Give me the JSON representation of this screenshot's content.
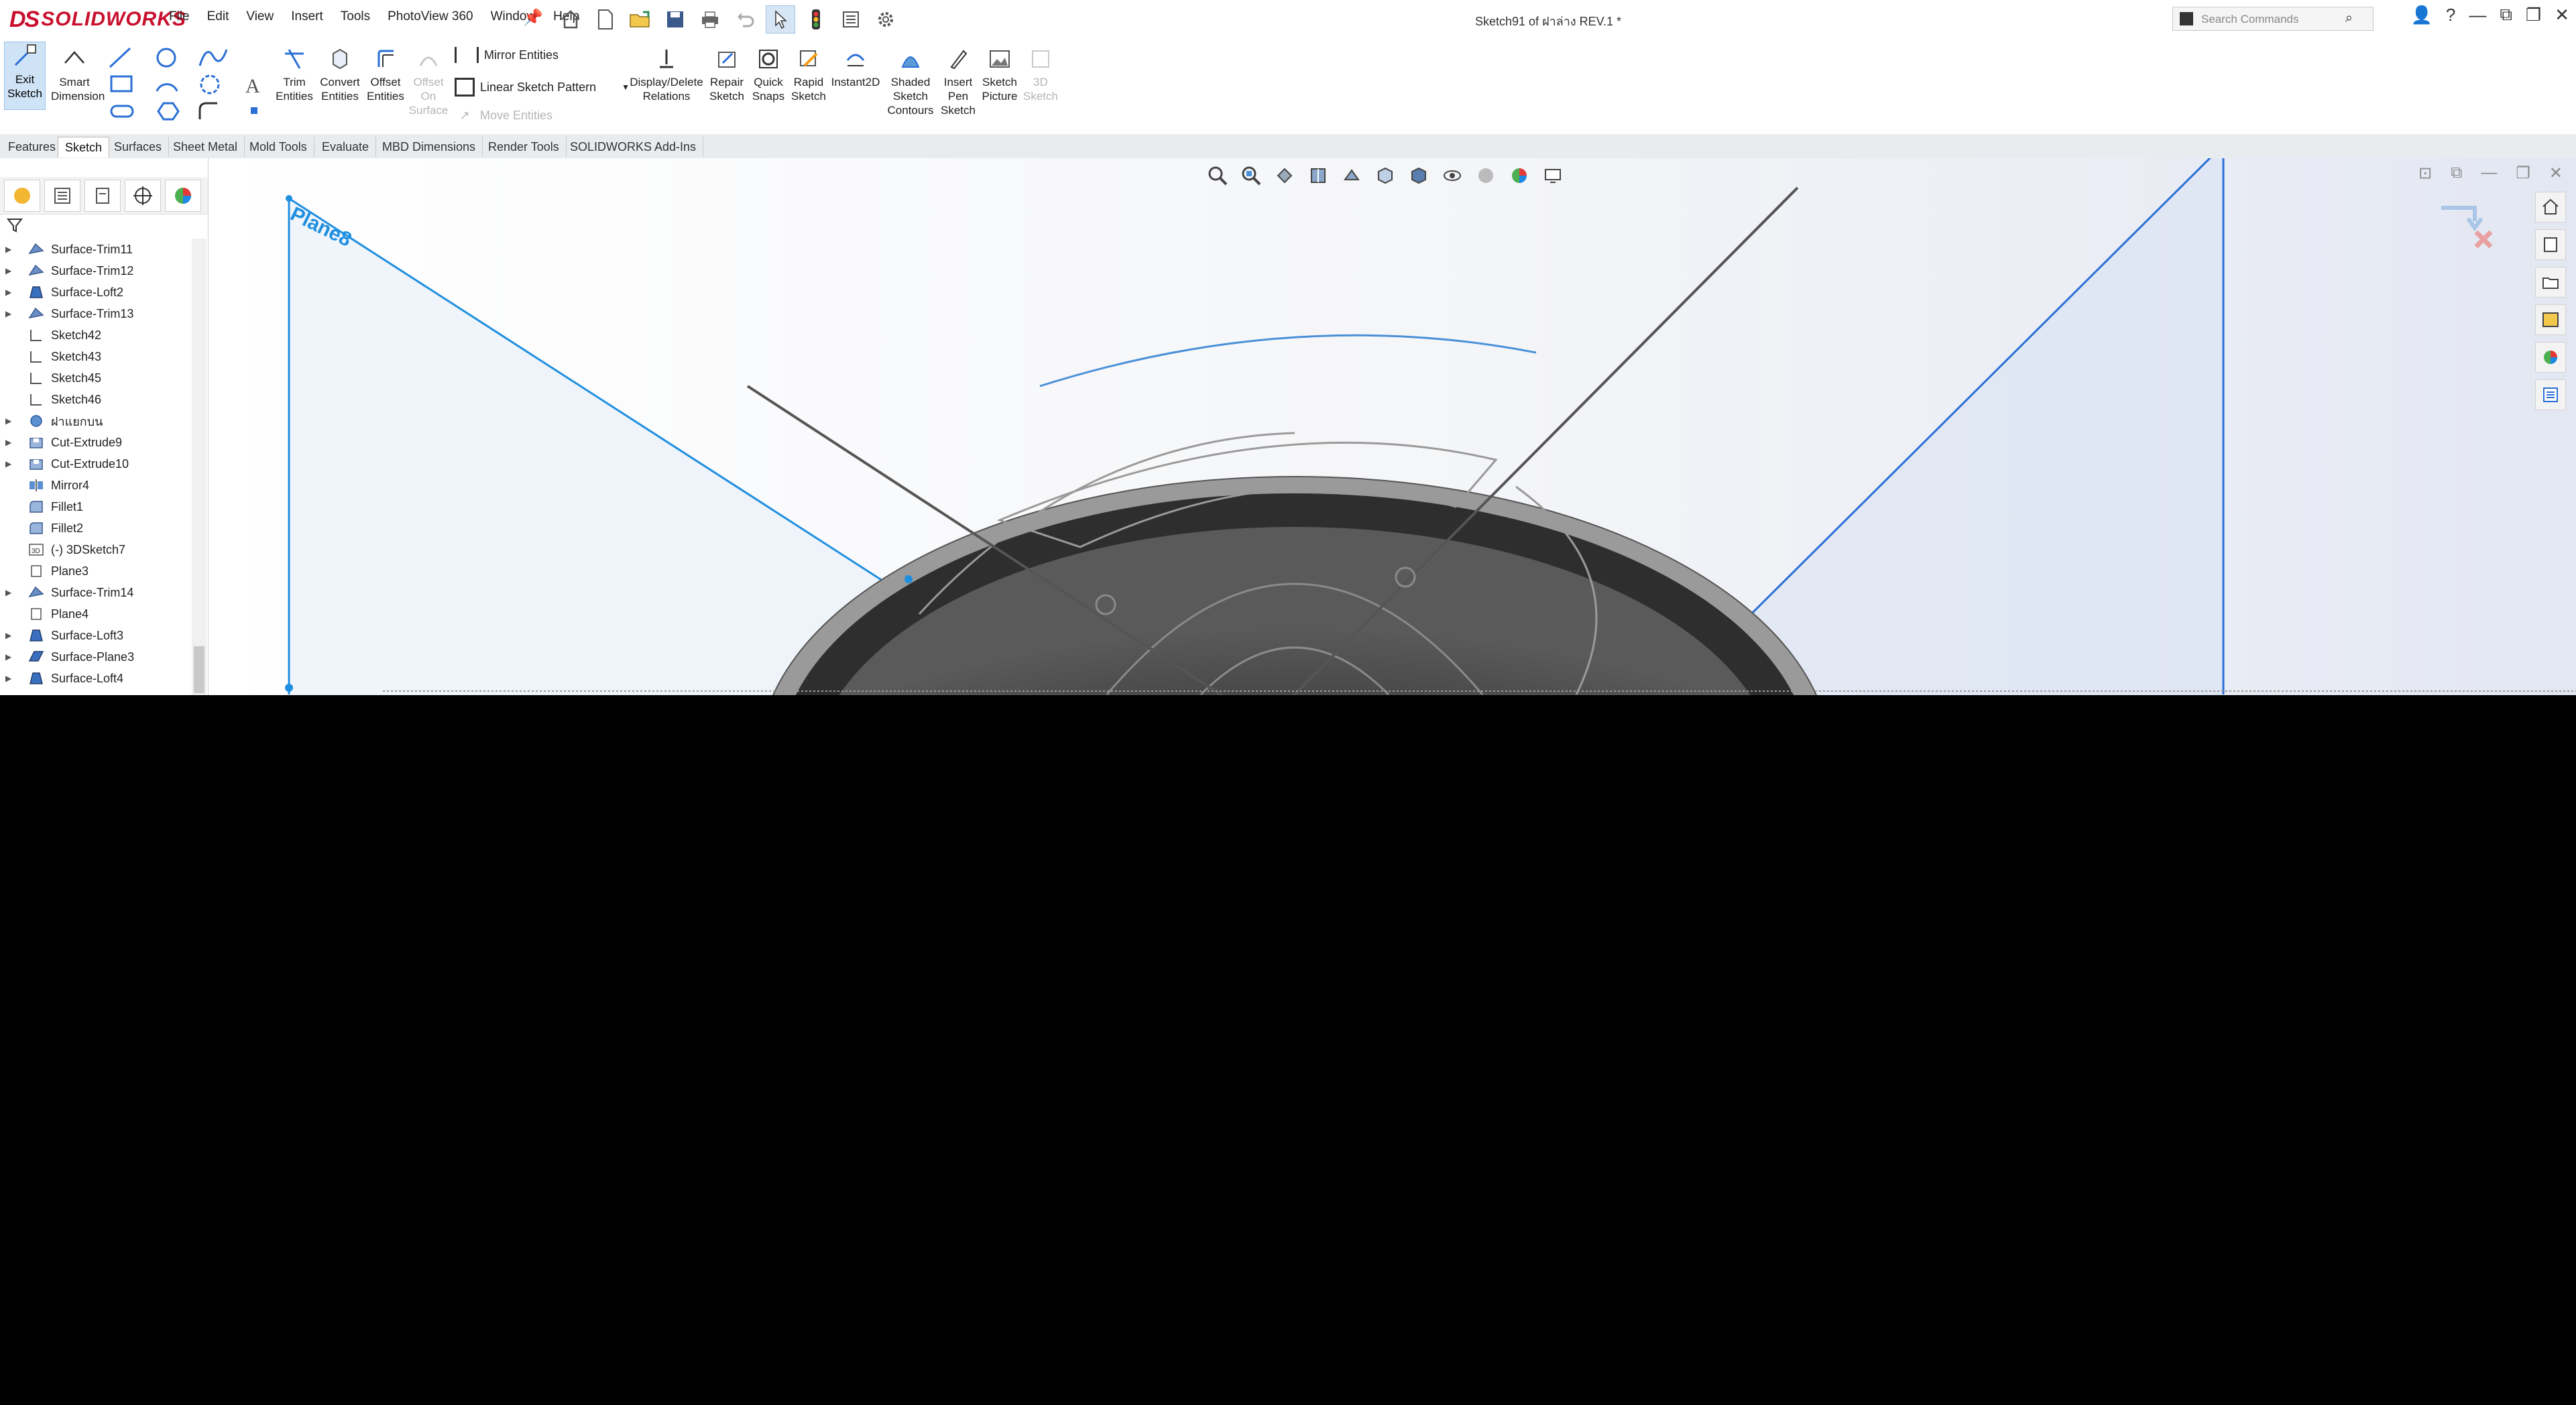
{
  "app": {
    "brand_ds": "DS",
    "brand_name": "SOLIDWORKS"
  },
  "menu": [
    "File",
    "Edit",
    "View",
    "Insert",
    "Tools",
    "PhotoView 360",
    "Window",
    "Help"
  ],
  "document": {
    "title": "Sketch91 of ฝาล่าง REV.1 *"
  },
  "search": {
    "placeholder": "Search Commands"
  },
  "commands": {
    "exit_sketch": "Exit Sketch",
    "smart_dimension": "Smart Dimension",
    "trim_entities": "Trim Entities",
    "convert_entities": "Convert Entities",
    "offset_entities": "Offset Entities",
    "offset_on_surface": "Offset On Surface",
    "mirror_entities": "Mirror Entities",
    "linear_sketch_pattern": "Linear Sketch Pattern",
    "move_entities": "Move Entities",
    "display_delete_relations": "Display/Delete Relations",
    "repair_sketch": "Repair Sketch",
    "quick_snaps": "Quick Snaps",
    "rapid_sketch": "Rapid Sketch",
    "instant2d": "Instant2D",
    "shaded_sketch_contours": "Shaded Sketch Contours",
    "insert_pen_sketch": "Insert Pen Sketch",
    "sketch_picture": "Sketch Picture",
    "3d_sketch": "3D Sketch"
  },
  "tabs": [
    "Features",
    "Sketch",
    "Surfaces",
    "Sheet Metal",
    "Mold Tools",
    "Evaluate",
    "MBD Dimensions",
    "Render Tools",
    "SOLIDWORKS Add-Ins"
  ],
  "active_tab": "Sketch",
  "feature_tree": [
    {
      "label": "Surface-Trim11",
      "icon": "surface-trim-icon",
      "expand": true
    },
    {
      "label": "Surface-Trim12",
      "icon": "surface-trim-icon",
      "expand": true
    },
    {
      "label": "Surface-Loft2",
      "icon": "surface-loft-icon",
      "expand": true
    },
    {
      "label": "Surface-Trim13",
      "icon": "surface-trim-icon",
      "expand": true
    },
    {
      "label": "Sketch42",
      "icon": "sketch-icon",
      "expand": false
    },
    {
      "label": "Sketch43",
      "icon": "sketch-icon",
      "expand": false
    },
    {
      "label": "Sketch45",
      "icon": "sketch-icon",
      "expand": false
    },
    {
      "label": "Sketch46",
      "icon": "sketch-icon",
      "expand": false
    },
    {
      "label": "ฝาแยกบน",
      "icon": "revolve-icon",
      "expand": true
    },
    {
      "label": "Cut-Extrude9",
      "icon": "cut-extrude-icon",
      "expand": true
    },
    {
      "label": "Cut-Extrude10",
      "icon": "cut-extrude-icon",
      "expand": true
    },
    {
      "label": "Mirror4",
      "icon": "mirror-icon",
      "expand": false
    },
    {
      "label": "Fillet1",
      "icon": "fillet-icon",
      "expand": false
    },
    {
      "label": "Fillet2",
      "icon": "fillet-icon",
      "expand": false
    },
    {
      "label": "(-) 3DSketch7",
      "icon": "3dsketch-icon",
      "expand": false
    },
    {
      "label": "Plane3",
      "icon": "plane-icon",
      "expand": false
    },
    {
      "label": "Surface-Trim14",
      "icon": "surface-trim-icon",
      "expand": true
    },
    {
      "label": "Plane4",
      "icon": "plane-icon",
      "expand": false
    },
    {
      "label": "Surface-Loft3",
      "icon": "surface-loft-icon",
      "expand": true
    },
    {
      "label": "Surface-Plane3",
      "icon": "surface-plane-icon",
      "expand": true
    },
    {
      "label": "Surface-Loft4",
      "icon": "surface-loft-icon",
      "expand": true
    }
  ],
  "viewport": {
    "plane_label": "Plane8",
    "accent": "#1f8fe0",
    "sketch_line": "#2b6fd6"
  }
}
